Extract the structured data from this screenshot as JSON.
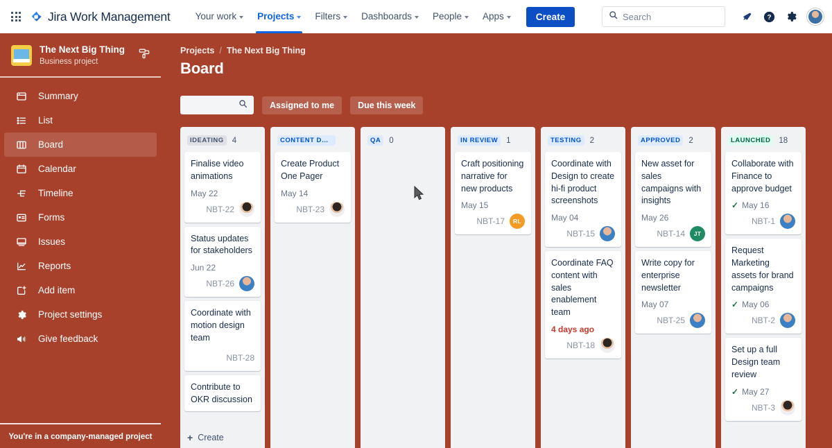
{
  "topnav": {
    "app_switcher_icon": "grid-apps-icon",
    "brand": "Jira Work Management",
    "brand_logo_icon": "jira-logo-icon",
    "items": [
      {
        "label": "Your work",
        "has_caret": true,
        "active": false
      },
      {
        "label": "Projects",
        "has_caret": true,
        "active": true
      },
      {
        "label": "Filters",
        "has_caret": true,
        "active": false
      },
      {
        "label": "Dashboards",
        "has_caret": true,
        "active": false
      },
      {
        "label": "People",
        "has_caret": true,
        "active": false
      },
      {
        "label": "Apps",
        "has_caret": true,
        "active": false
      }
    ],
    "create_label": "Create",
    "search_placeholder": "Search",
    "search_value": "",
    "search_icon": "search-icon",
    "notifications_icon": "bell-icon",
    "help_icon": "help-circle-icon",
    "settings_icon": "gear-icon",
    "avatar_icon": "user-avatar"
  },
  "sidebar": {
    "project_name": "The Next Big Thing",
    "project_type": "Business project",
    "project_icon": "project-avatar-icon",
    "paint_icon": "paint-roller-icon",
    "items": [
      {
        "label": "Summary",
        "icon": "summary-icon",
        "active": false
      },
      {
        "label": "List",
        "icon": "list-icon",
        "active": false
      },
      {
        "label": "Board",
        "icon": "board-icon",
        "active": true
      },
      {
        "label": "Calendar",
        "icon": "calendar-icon",
        "active": false
      },
      {
        "label": "Timeline",
        "icon": "timeline-icon",
        "active": false
      },
      {
        "label": "Forms",
        "icon": "forms-icon",
        "active": false
      },
      {
        "label": "Issues",
        "icon": "issues-icon",
        "active": false
      },
      {
        "label": "Reports",
        "icon": "reports-icon",
        "active": false
      },
      {
        "label": "Add item",
        "icon": "add-item-icon",
        "active": false
      },
      {
        "label": "Project settings",
        "icon": "gear-icon",
        "active": false
      },
      {
        "label": "Give feedback",
        "icon": "megaphone-icon",
        "active": false
      }
    ],
    "footer_note": "You're in a company-managed project"
  },
  "main": {
    "breadcrumb": {
      "root": "Projects",
      "separator": "/",
      "current": "The Next Big Thing"
    },
    "page_title": "Board",
    "filters": {
      "search_value": "",
      "search_placeholder": "",
      "search_icon": "search-icon",
      "chips": [
        {
          "label": "Assigned to me"
        },
        {
          "label": "Due this week"
        }
      ]
    },
    "create_label": "Create",
    "create_icon": "plus-icon"
  },
  "colors": {
    "brand_red": "#A8412C",
    "accent_blue": "#0C66E4",
    "create_blue": "#0C4FC4",
    "column_bg": "#F1F2F4",
    "card_bg": "#FFFFFF",
    "badge_blue_bg": "#DEEBFF",
    "badge_blue_fg": "#0052CC",
    "badge_gray_bg": "#DFE1E6",
    "badge_gray_fg": "#42526E",
    "badge_green_bg": "#DFFCF0",
    "badge_green_fg": "#006644",
    "overdue_red": "#C9372C",
    "done_green": "#216E4E"
  },
  "board": {
    "columns": [
      {
        "name": "IDEATING",
        "count": "4",
        "badge_style": "gray",
        "show_create": true,
        "cards": [
          {
            "title": "Finalise video animations",
            "date": "May 22",
            "key": "NBT-22",
            "done": false,
            "overdue": false,
            "avatar": {
              "type": "photo",
              "style": "photo-dark"
            }
          },
          {
            "title": "Status updates for stakeholders",
            "date": "Jun 22",
            "key": "NBT-26",
            "done": false,
            "overdue": false,
            "avatar": {
              "type": "photo",
              "style": "photo-blue"
            }
          },
          {
            "title": "Coordinate with motion design team",
            "date": "",
            "key": "NBT-28",
            "done": false,
            "overdue": false,
            "avatar": null
          },
          {
            "title": "Contribute to OKR discussion",
            "date": "",
            "key": "",
            "done": false,
            "overdue": false,
            "avatar": null
          }
        ]
      },
      {
        "name": "CONTENT DEVE...",
        "count": "",
        "badge_style": "blue",
        "show_create": false,
        "cards": [
          {
            "title": "Create Product One Pager",
            "date": "May 14",
            "key": "NBT-23",
            "done": false,
            "overdue": false,
            "avatar": {
              "type": "photo",
              "style": "photo-dark"
            }
          }
        ]
      },
      {
        "name": "QA",
        "count": "0",
        "badge_style": "blue",
        "show_create": false,
        "cards": []
      },
      {
        "name": "IN REVIEW",
        "count": "1",
        "badge_style": "blue",
        "show_create": false,
        "cards": [
          {
            "title": "Craft positioning narrative for new products",
            "date": "May 15",
            "key": "NBT-17",
            "done": false,
            "overdue": false,
            "avatar": {
              "type": "initials",
              "initials": "RL",
              "color": "#F59B23"
            }
          }
        ]
      },
      {
        "name": "TESTING",
        "count": "2",
        "badge_style": "blue",
        "show_create": false,
        "cards": [
          {
            "title": "Coordinate with Design to create hi-fi product screenshots",
            "date": "May 04",
            "key": "NBT-15",
            "done": false,
            "overdue": false,
            "avatar": {
              "type": "photo",
              "style": "photo-blue"
            }
          },
          {
            "title": "Coordinate FAQ content with sales enablement team",
            "date": "4 days ago",
            "key": "NBT-18",
            "done": false,
            "overdue": true,
            "avatar": {
              "type": "photo",
              "style": "photo-dark"
            }
          }
        ]
      },
      {
        "name": "APPROVED",
        "count": "2",
        "badge_style": "blue",
        "show_create": false,
        "cards": [
          {
            "title": "New asset for sales campaigns with insights",
            "date": "May 26",
            "key": "NBT-14",
            "done": false,
            "overdue": false,
            "avatar": {
              "type": "initials",
              "initials": "JT",
              "color": "#1F8B63"
            }
          },
          {
            "title": "Write copy for enterprise newsletter",
            "date": "May 07",
            "key": "NBT-25",
            "done": false,
            "overdue": false,
            "avatar": {
              "type": "photo",
              "style": "photo-blue"
            }
          }
        ]
      },
      {
        "name": "LAUNCHED",
        "count": "18",
        "badge_style": "green",
        "show_create": false,
        "cards": [
          {
            "title": "Collaborate with Finance to approve budget",
            "date": "May 16",
            "key": "NBT-1",
            "done": true,
            "overdue": false,
            "avatar": {
              "type": "photo",
              "style": "photo-blue"
            }
          },
          {
            "title": "Request Marketing assets for brand campaigns",
            "date": "May 06",
            "key": "NBT-2",
            "done": true,
            "overdue": false,
            "avatar": {
              "type": "photo",
              "style": "photo-blue"
            }
          },
          {
            "title": "Set up a full Design team review",
            "date": "May 27",
            "key": "NBT-3",
            "done": true,
            "overdue": false,
            "avatar": {
              "type": "photo",
              "style": "photo-dark"
            }
          }
        ]
      }
    ]
  },
  "cursor": {
    "icon": "mouse-pointer-icon"
  }
}
